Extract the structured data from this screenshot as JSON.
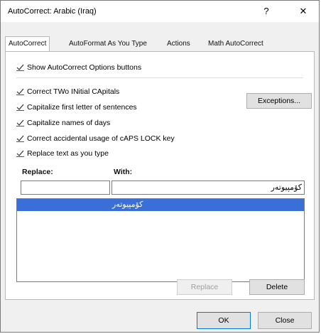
{
  "window": {
    "title": "AutoCorrect: Arabic (Iraq)",
    "help_glyph": "?",
    "close_glyph": "✕"
  },
  "tabs": [
    {
      "label": "AutoCorrect",
      "active": true
    },
    {
      "label": "AutoFormat As You Type",
      "active": false
    },
    {
      "label": "Actions",
      "active": false
    },
    {
      "label": "Math AutoCorrect",
      "active": false
    }
  ],
  "options": {
    "show_buttons": {
      "label": "Show AutoCorrect Options buttons",
      "checked": true
    },
    "two_initial": {
      "label": "Correct TWo INitial CApitals",
      "checked": true
    },
    "capitalize_first": {
      "label": "Capitalize first letter of sentences",
      "checked": true
    },
    "capitalize_days": {
      "label": "Capitalize names of days",
      "checked": true
    },
    "caps_lock": {
      "label": "Correct accidental usage of cAPS LOCK key",
      "checked": true
    },
    "replace_as_type": {
      "label": "Replace text as you type",
      "checked": true
    }
  },
  "exceptions_label": "Exceptions...",
  "replace": {
    "replace_label": "Replace:",
    "with_label": "With:",
    "replace_value": "",
    "with_value": "كۆمپیوتەر"
  },
  "list_rows": [
    {
      "from": "",
      "to": "كۆمپیوتەر",
      "selected": true
    }
  ],
  "buttons": {
    "replace": "Replace",
    "delete": "Delete",
    "ok": "OK",
    "close": "Close"
  },
  "colors": {
    "selection": "#3b6fd8",
    "default_button_border": "#0078d7"
  }
}
